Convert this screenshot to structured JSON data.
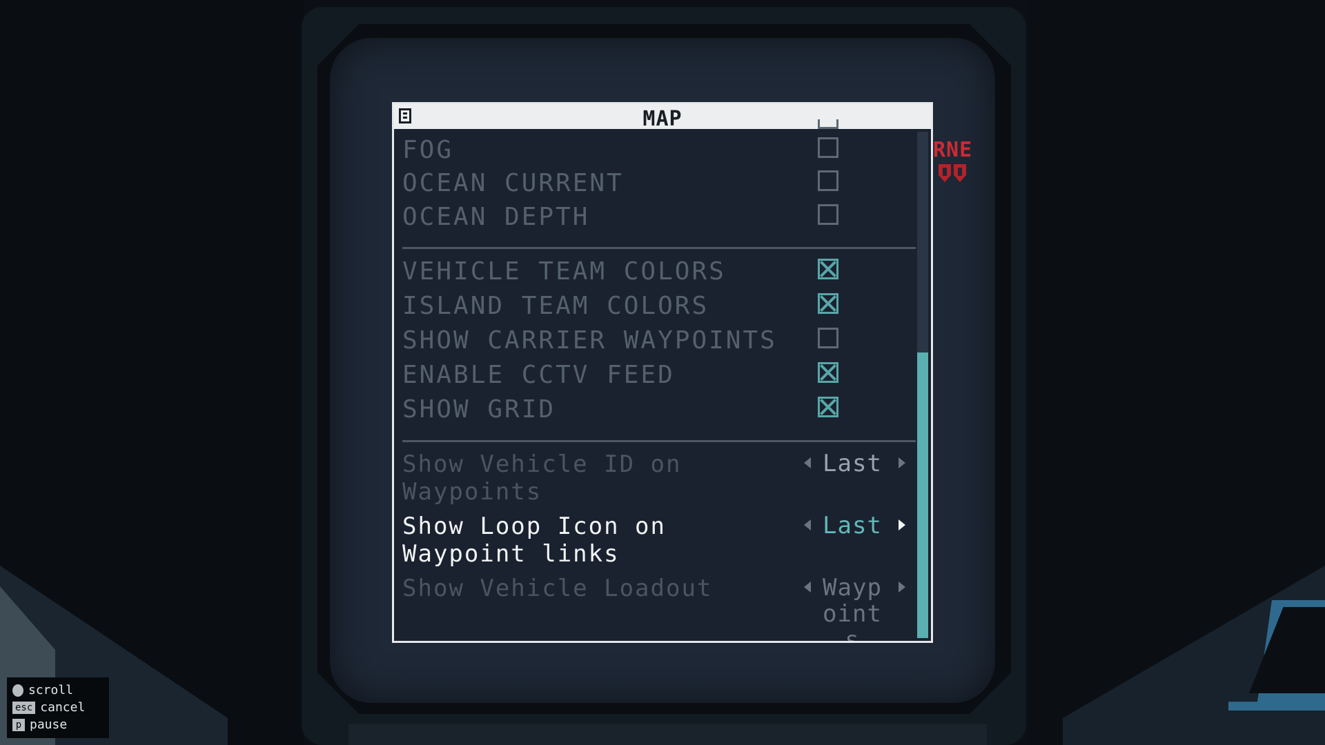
{
  "window": {
    "title": "MAP"
  },
  "hud": {
    "partial_text": "RNE"
  },
  "toggles_group1": [
    {
      "label": "FOG",
      "checked": false
    },
    {
      "label": "OCEAN CURRENT",
      "checked": false
    },
    {
      "label": "OCEAN DEPTH",
      "checked": false
    }
  ],
  "toggles_group2": [
    {
      "label": "VEHICLE TEAM COLORS",
      "checked": true
    },
    {
      "label": "ISLAND TEAM COLORS",
      "checked": true
    },
    {
      "label": "SHOW CARRIER WAYPOINTS",
      "checked": false
    },
    {
      "label": "ENABLE CCTV FEED",
      "checked": true
    },
    {
      "label": "SHOW GRID",
      "checked": true
    }
  ],
  "options": [
    {
      "label": "Show Vehicle ID on Waypoints",
      "value": "Last",
      "active": false
    },
    {
      "label": "Show Loop Icon on Waypoint links",
      "value": "Last",
      "active": true
    },
    {
      "label": "Show Vehicle Loadout",
      "value": "Waypoints",
      "active": false
    }
  ],
  "legend": [
    {
      "key": "",
      "icon": "mouse-icon",
      "action": "scroll"
    },
    {
      "key": "esc",
      "action": "cancel"
    },
    {
      "key": "p",
      "action": "pause"
    }
  ],
  "colors": {
    "accent": "#59a7a8",
    "hud_red": "#cc2a32",
    "window_bg": "#1a2230",
    "titlebar": "#eceeef"
  }
}
